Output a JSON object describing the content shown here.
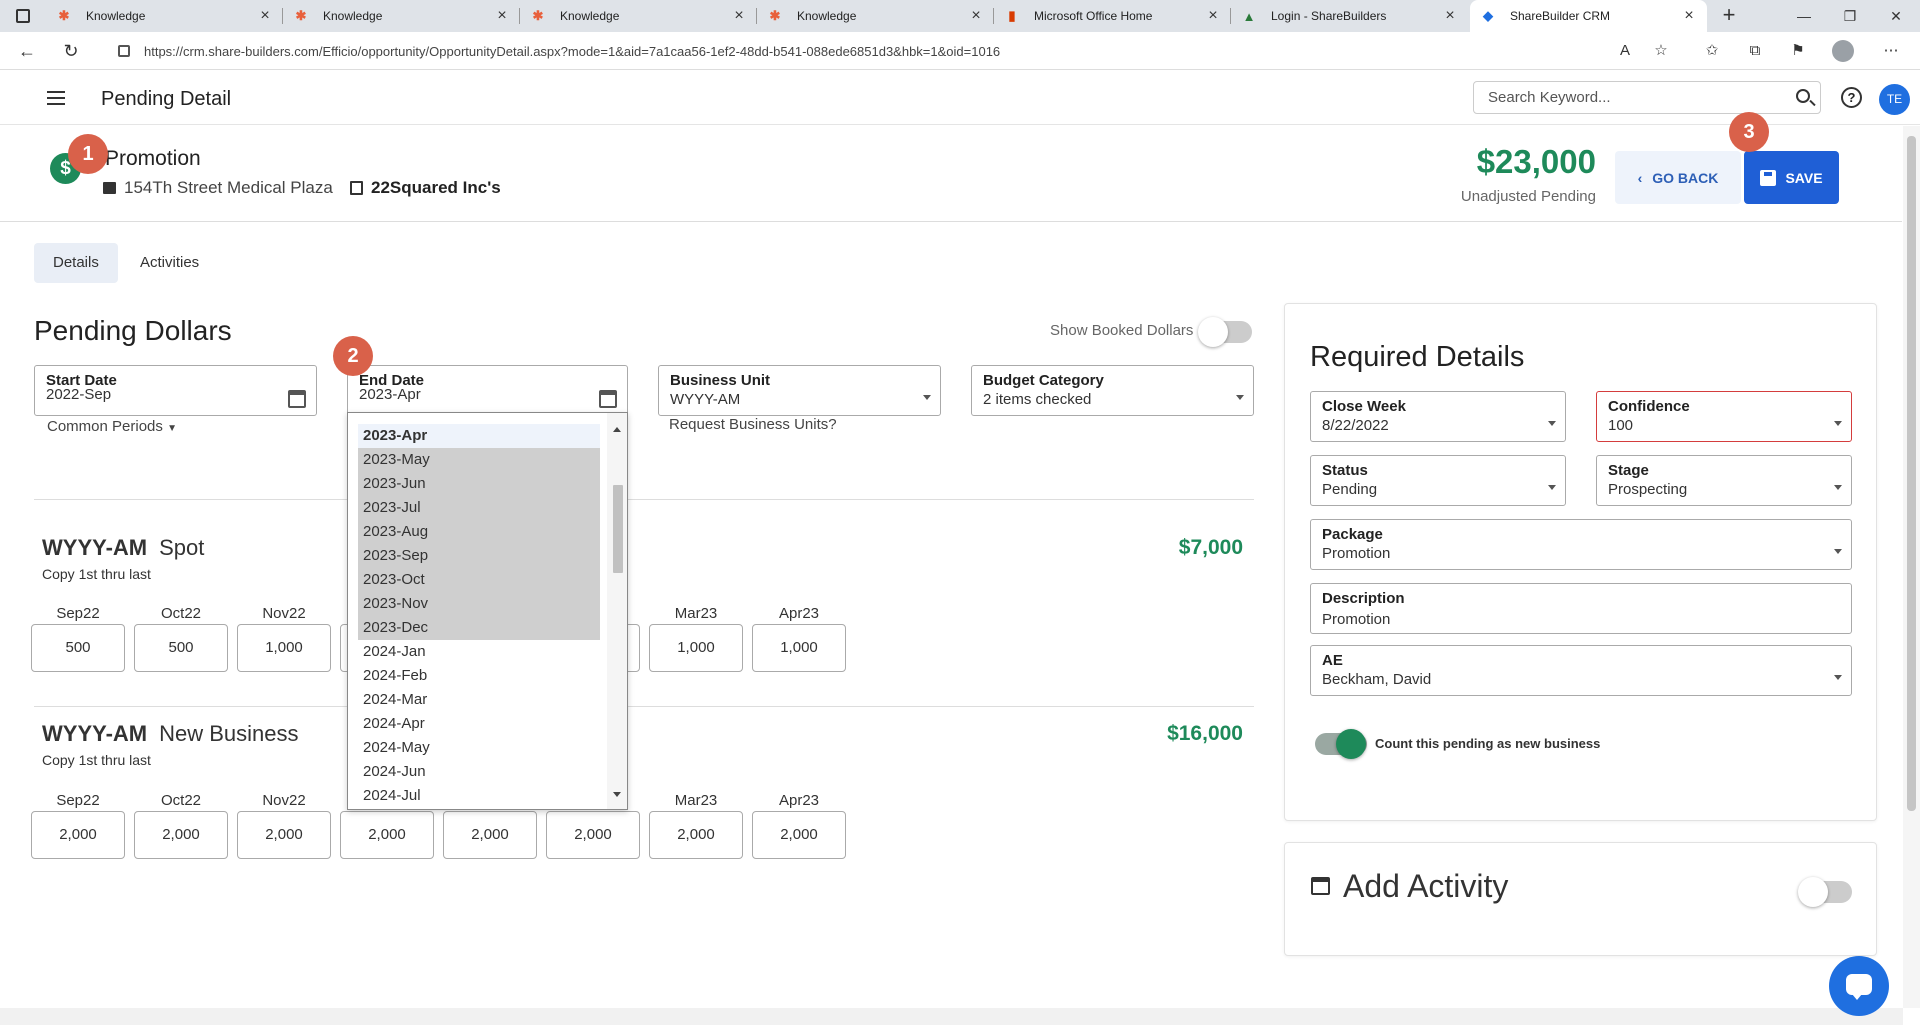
{
  "browser": {
    "tabs": [
      {
        "label": "Knowledge",
        "icon": "hubspot-icon"
      },
      {
        "label": "Knowledge",
        "icon": "hubspot-icon"
      },
      {
        "label": "Knowledge",
        "icon": "hubspot-icon"
      },
      {
        "label": "Knowledge",
        "icon": "hubspot-icon"
      },
      {
        "label": "Microsoft Office Home",
        "icon": "office-icon"
      },
      {
        "label": "Login - ShareBuilders",
        "icon": "sharebuilders-icon"
      },
      {
        "label": "ShareBuilder CRM",
        "icon": "sharebuilder-crm-icon"
      }
    ],
    "url": "https://crm.share-builders.com/Efficio/opportunity/OpportunityDetail.aspx?mode=1&aid=7a1caa56-1ef2-48dd-b541-088ede6851d3&hbk=1&oid=1016"
  },
  "header": {
    "title": "Pending Detail",
    "search_placeholder": "Search Keyword...",
    "avatar": "TE"
  },
  "opportunity": {
    "name": "Promotion",
    "location": "154Th Street Medical Plaza",
    "account": "22Squared Inc's",
    "amount": "$23,000",
    "amount_label": "Unadjusted Pending",
    "go_back": "GO BACK",
    "save": "SAVE"
  },
  "badges": [
    "1",
    "2",
    "3"
  ],
  "tabs": [
    "Details",
    "Activities"
  ],
  "pending": {
    "title": "Pending Dollars",
    "show_booked": "Show Booked Dollars",
    "start_date": {
      "label": "Start Date",
      "value": "2022-Sep"
    },
    "end_date": {
      "label": "End Date",
      "value": "2023-Apr"
    },
    "business_unit": {
      "label": "Business Unit",
      "value": "WYYY-AM"
    },
    "budget_category": {
      "label": "Budget Category",
      "value": "2 items checked"
    },
    "common_periods": "Common Periods",
    "request_units": "Request Business Units?",
    "groups": [
      {
        "unit": "WYYY-AM",
        "type": "Spot",
        "copy": "Copy 1st thru last",
        "total": "$7,000",
        "months": [
          {
            "label": "Sep22",
            "value": "500"
          },
          {
            "label": "Oct22",
            "value": "500"
          },
          {
            "label": "Nov22",
            "value": "1,000"
          },
          {
            "label": "",
            "value": ""
          },
          {
            "label": "",
            "value": ""
          },
          {
            "label": "23",
            "value": ""
          },
          {
            "label": "Mar23",
            "value": "1,000"
          },
          {
            "label": "Apr23",
            "value": "1,000"
          }
        ]
      },
      {
        "unit": "WYYY-AM",
        "type": "New Business",
        "copy": "Copy 1st thru last",
        "total": "$16,000",
        "months": [
          {
            "label": "Sep22",
            "value": "2,000"
          },
          {
            "label": "Oct22",
            "value": "2,000"
          },
          {
            "label": "Nov22",
            "value": "2,000"
          },
          {
            "label": "",
            "value": "2,000"
          },
          {
            "label": "",
            "value": "2,000"
          },
          {
            "label": "23",
            "value": "2,000"
          },
          {
            "label": "Mar23",
            "value": "2,000"
          },
          {
            "label": "Apr23",
            "value": "2,000"
          }
        ]
      }
    ],
    "dropdown_options": [
      "2023-Apr",
      "2023-May",
      "2023-Jun",
      "2023-Jul",
      "2023-Aug",
      "2023-Sep",
      "2023-Oct",
      "2023-Nov",
      "2023-Dec",
      "2024-Jan",
      "2024-Feb",
      "2024-Mar",
      "2024-Apr",
      "2024-May",
      "2024-Jun",
      "2024-Jul"
    ]
  },
  "required": {
    "title": "Required Details",
    "close_week": {
      "label": "Close Week",
      "value": "8/22/2022"
    },
    "confidence": {
      "label": "Confidence",
      "value": "100"
    },
    "status": {
      "label": "Status",
      "value": "Pending"
    },
    "stage": {
      "label": "Stage",
      "value": "Prospecting"
    },
    "package": {
      "label": "Package",
      "value": "Promotion"
    },
    "description": {
      "label": "Description",
      "value": "Promotion"
    },
    "ae": {
      "label": "AE",
      "value": "Beckham, David"
    },
    "new_business": "Count this pending as new business"
  },
  "activity": {
    "title": "Add Activity"
  },
  "colors": {
    "accent": "#1f5fd6",
    "money": "#1e8a5a",
    "badge": "#d9614a",
    "error": "#d43d3d"
  }
}
